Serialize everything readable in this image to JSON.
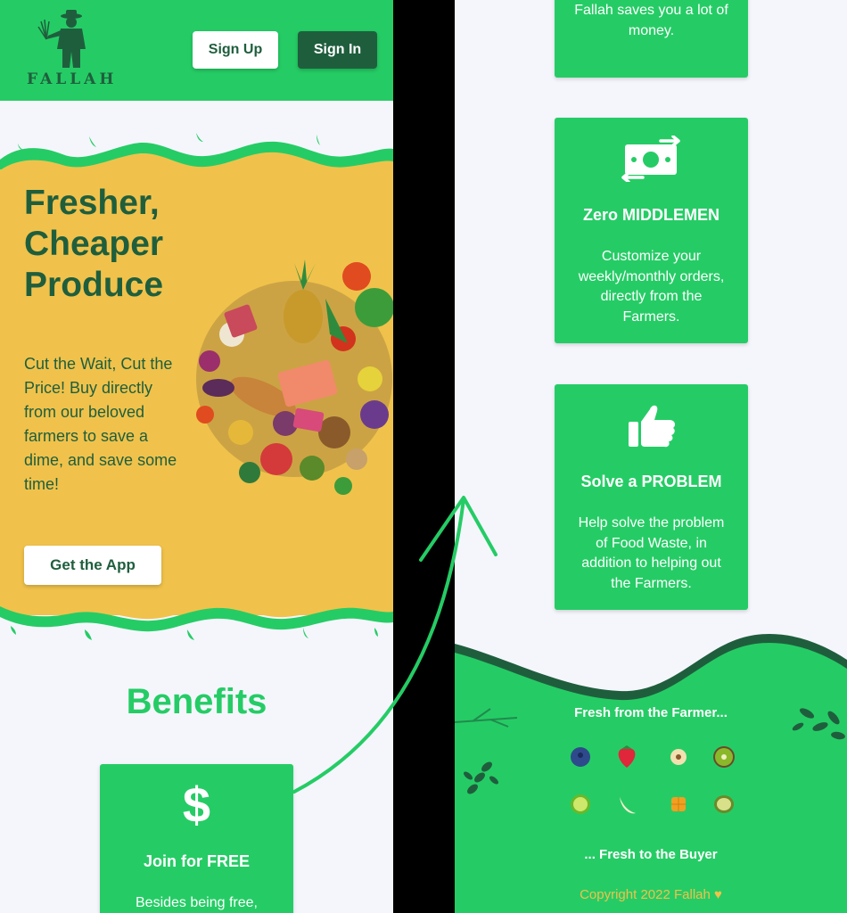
{
  "brand": {
    "name": "FALLAH"
  },
  "header": {
    "signup_label": "Sign Up",
    "signin_label": "Sign In"
  },
  "hero": {
    "title": "Fresher, Cheaper Produce",
    "text": "Cut the Wait, Cut the Price! Buy directly from our beloved farmers to save a dime, and save some time!",
    "cta_label": "Get the App"
  },
  "benefits": {
    "title": "Benefits",
    "cards": [
      {
        "icon": "dollar-icon",
        "title": "Join for FREE",
        "desc": "Besides being free,"
      },
      {
        "icon": "",
        "title": "",
        "desc": "Fallah saves you a lot of money."
      },
      {
        "icon": "money-exchange-icon",
        "title": "Zero MIDDLEMEN",
        "desc": "Customize your weekly/monthly orders, directly from the Farmers."
      },
      {
        "icon": "thumbs-up-icon",
        "title": "Solve a PROBLEM",
        "desc": "Help solve the problem of Food Waste, in addition to helping out the Farmers."
      }
    ]
  },
  "footer": {
    "top_text": "Fresh from the Farmer...",
    "bottom_text": "... Fresh to the Buyer",
    "copyright": "Copyright 2022 Fallah",
    "fruits": [
      "blueberry",
      "strawberry",
      "apple-slice",
      "kiwi",
      "lime",
      "banana",
      "mango",
      "avocado"
    ]
  },
  "colors": {
    "green": "#25cc65",
    "dark_green": "#1f5e3d",
    "yellow": "#f0c24b",
    "background": "#f4f6fc"
  }
}
